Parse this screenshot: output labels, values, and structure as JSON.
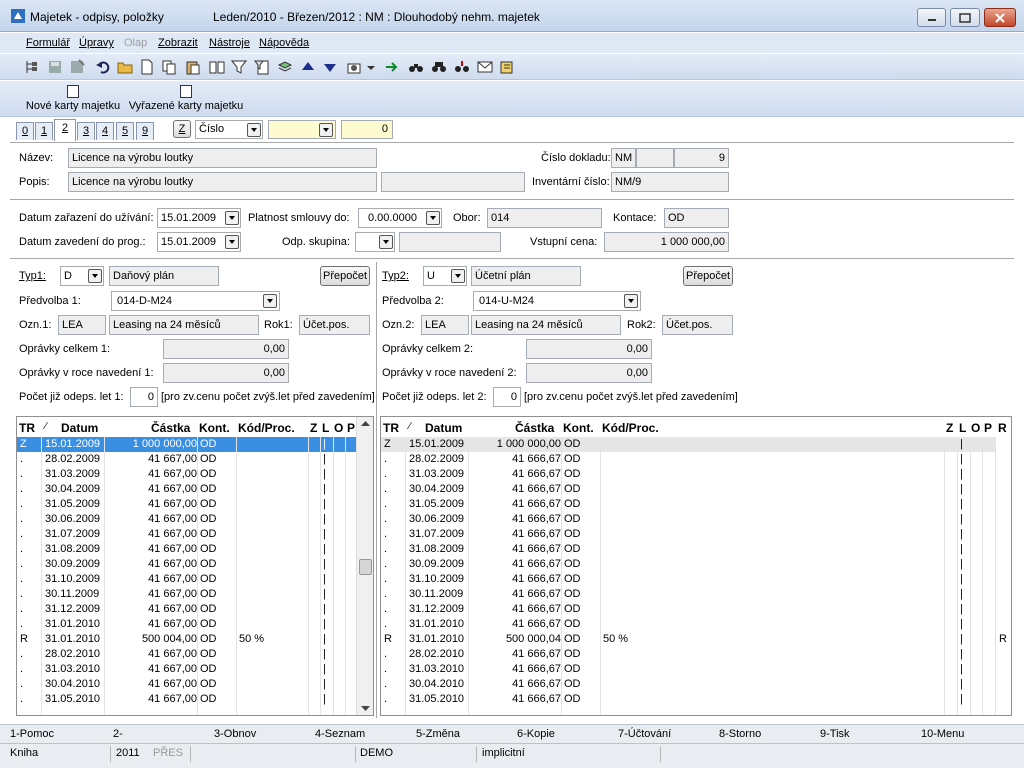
{
  "window": {
    "title": "Majetek - odpisy, položky",
    "subtitle": "Leden/2010 - Březen/2012 : NM : Dlouhodobý nehm. majetek"
  },
  "menu": [
    "Formulář",
    "Úpravy",
    "Olap",
    "Zobrazit",
    "Nástroje",
    "Nápověda"
  ],
  "toolbar2": {
    "new_cards": "Nové karty majetku",
    "discarded_cards": "Vyřazené karty majetku"
  },
  "tabs": [
    "0",
    "1",
    "2",
    "3",
    "4",
    "5",
    "9"
  ],
  "tabs_active": "2",
  "filter": {
    "z_label": "Z",
    "sort_field": "Číslo",
    "count": "0"
  },
  "header": {
    "nazev_label": "Název:",
    "nazev": "Licence na výrobu loutky",
    "popis_label": "Popis:",
    "popis": "Licence na výrobu loutky",
    "cislo_dokladu_label": "Číslo dokladu:",
    "doc_series": "NM",
    "doc_number": "9",
    "inventarni_label": "Inventární číslo:",
    "inventarni": "NM/9"
  },
  "dates": {
    "zarazeni_label": "Datum zařazení do užívání:",
    "zarazeni": "15.01.2009",
    "platnost_label": "Platnost smlouvy do:",
    "platnost": "0.00.0000",
    "obor_label": "Obor:",
    "obor": "014",
    "kontace_label": "Kontace:",
    "kontace": "OD",
    "zavedeni_label": "Datum zavedení do prog.:",
    "zavedeni": "15.01.2009",
    "skupina_label": "Odp. skupina:",
    "vstupni_label": "Vstupní cena:",
    "vstupni": "1 000 000,00"
  },
  "left": {
    "typ_label": "Typ1:",
    "typ": "D",
    "typ_name": "Daňový plán",
    "recalc": "Přepočet",
    "predvolba_label": "Předvolba 1:",
    "predvolba": "014-D-M24",
    "ozn_label": "Ozn.1:",
    "ozn": "LEA",
    "ozn_name": "Leasing na 24 měsíců",
    "rok_label": "Rok1:",
    "rok": "Účet.pos.",
    "opravky_celkem_label": "Oprávky celkem 1:",
    "opravky_celkem": "0,00",
    "opravky_roce_label": "Oprávky v roce navedení 1:",
    "opravky_roce": "0,00",
    "pocet_label": "Počet již odeps. let 1:",
    "pocet": "0",
    "pocet_note": "[pro zv.cenu počet zvýš.let před zavedením]"
  },
  "right": {
    "typ_label": "Typ2:",
    "typ": "U",
    "typ_name": "Účetní plán",
    "recalc": "Přepočet",
    "predvolba_label": "Předvolba 2:",
    "predvolba": "014-U-M24",
    "ozn_label": "Ozn.2:",
    "ozn": "LEA",
    "ozn_name": "Leasing na 24 měsíců",
    "rok_label": "Rok2:",
    "rok": "Účet.pos.",
    "opravky_celkem_label": "Oprávky celkem 2:",
    "opravky_celkem": "0,00",
    "opravky_roce_label": "Oprávky v roce navedení 2:",
    "opravky_roce": "0,00",
    "pocet_label": "Počet již odeps. let 2:",
    "pocet": "0",
    "pocet_note": "[pro zv.cenu počet zvýš.let před zavedením]"
  },
  "grid_columns": [
    "TR",
    "Datum",
    "Částka",
    "Kont.",
    "Kód/Proc.",
    "Z",
    "L",
    "O",
    "P",
    "R"
  ],
  "left_rows": [
    {
      "tr": "Z",
      "date": "15.01.2009",
      "amount": "1 000 000,00",
      "kont": "OD",
      "kod": ""
    },
    {
      "tr": ".",
      "date": "28.02.2009",
      "amount": "41 667,00",
      "kont": "OD",
      "kod": ""
    },
    {
      "tr": ".",
      "date": "31.03.2009",
      "amount": "41 667,00",
      "kont": "OD",
      "kod": ""
    },
    {
      "tr": ".",
      "date": "30.04.2009",
      "amount": "41 667,00",
      "kont": "OD",
      "kod": ""
    },
    {
      "tr": ".",
      "date": "31.05.2009",
      "amount": "41 667,00",
      "kont": "OD",
      "kod": ""
    },
    {
      "tr": ".",
      "date": "30.06.2009",
      "amount": "41 667,00",
      "kont": "OD",
      "kod": ""
    },
    {
      "tr": ".",
      "date": "31.07.2009",
      "amount": "41 667,00",
      "kont": "OD",
      "kod": ""
    },
    {
      "tr": ".",
      "date": "31.08.2009",
      "amount": "41 667,00",
      "kont": "OD",
      "kod": ""
    },
    {
      "tr": ".",
      "date": "30.09.2009",
      "amount": "41 667,00",
      "kont": "OD",
      "kod": ""
    },
    {
      "tr": ".",
      "date": "31.10.2009",
      "amount": "41 667,00",
      "kont": "OD",
      "kod": ""
    },
    {
      "tr": ".",
      "date": "30.11.2009",
      "amount": "41 667,00",
      "kont": "OD",
      "kod": ""
    },
    {
      "tr": ".",
      "date": "31.12.2009",
      "amount": "41 667,00",
      "kont": "OD",
      "kod": ""
    },
    {
      "tr": ".",
      "date": "31.01.2010",
      "amount": "41 667,00",
      "kont": "OD",
      "kod": ""
    },
    {
      "tr": "R",
      "date": "31.01.2010",
      "amount": "500 004,00",
      "kont": "OD",
      "kod": "50 %"
    },
    {
      "tr": ".",
      "date": "28.02.2010",
      "amount": "41 667,00",
      "kont": "OD",
      "kod": ""
    },
    {
      "tr": ".",
      "date": "31.03.2010",
      "amount": "41 667,00",
      "kont": "OD",
      "kod": ""
    },
    {
      "tr": ".",
      "date": "30.04.2010",
      "amount": "41 667,00",
      "kont": "OD",
      "kod": ""
    },
    {
      "tr": ".",
      "date": "31.05.2010",
      "amount": "41 667,00",
      "kont": "OD",
      "kod": ""
    }
  ],
  "right_rows": [
    {
      "tr": "Z",
      "date": "15.01.2009",
      "amount": "1 000 000,00",
      "kont": "OD",
      "kod": "",
      "r": ""
    },
    {
      "tr": ".",
      "date": "28.02.2009",
      "amount": "41 666,67",
      "kont": "OD",
      "kod": "",
      "r": ""
    },
    {
      "tr": ".",
      "date": "31.03.2009",
      "amount": "41 666,67",
      "kont": "OD",
      "kod": "",
      "r": ""
    },
    {
      "tr": ".",
      "date": "30.04.2009",
      "amount": "41 666,67",
      "kont": "OD",
      "kod": "",
      "r": ""
    },
    {
      "tr": ".",
      "date": "31.05.2009",
      "amount": "41 666,67",
      "kont": "OD",
      "kod": "",
      "r": ""
    },
    {
      "tr": ".",
      "date": "30.06.2009",
      "amount": "41 666,67",
      "kont": "OD",
      "kod": "",
      "r": ""
    },
    {
      "tr": ".",
      "date": "31.07.2009",
      "amount": "41 666,67",
      "kont": "OD",
      "kod": "",
      "r": ""
    },
    {
      "tr": ".",
      "date": "31.08.2009",
      "amount": "41 666,67",
      "kont": "OD",
      "kod": "",
      "r": ""
    },
    {
      "tr": ".",
      "date": "30.09.2009",
      "amount": "41 666,67",
      "kont": "OD",
      "kod": "",
      "r": ""
    },
    {
      "tr": ".",
      "date": "31.10.2009",
      "amount": "41 666,67",
      "kont": "OD",
      "kod": "",
      "r": ""
    },
    {
      "tr": ".",
      "date": "30.11.2009",
      "amount": "41 666,67",
      "kont": "OD",
      "kod": "",
      "r": ""
    },
    {
      "tr": ".",
      "date": "31.12.2009",
      "amount": "41 666,67",
      "kont": "OD",
      "kod": "",
      "r": ""
    },
    {
      "tr": ".",
      "date": "31.01.2010",
      "amount": "41 666,67",
      "kont": "OD",
      "kod": "",
      "r": ""
    },
    {
      "tr": "R",
      "date": "31.01.2010",
      "amount": "500 000,04",
      "kont": "OD",
      "kod": "50 %",
      "r": "R"
    },
    {
      "tr": ".",
      "date": "28.02.2010",
      "amount": "41 666,67",
      "kont": "OD",
      "kod": "",
      "r": ""
    },
    {
      "tr": ".",
      "date": "31.03.2010",
      "amount": "41 666,67",
      "kont": "OD",
      "kod": "",
      "r": ""
    },
    {
      "tr": ".",
      "date": "30.04.2010",
      "amount": "41 666,67",
      "kont": "OD",
      "kod": "",
      "r": ""
    },
    {
      "tr": ".",
      "date": "31.05.2010",
      "amount": "41 666,67",
      "kont": "OD",
      "kod": "",
      "r": ""
    }
  ],
  "fkeys": [
    "1-Pomoc",
    "2-",
    "3-Obnov",
    "4-Seznam",
    "5-Změna",
    "6-Kopie",
    "7-Účtování",
    "8-Storno",
    "9-Tisk",
    "10-Menu"
  ],
  "status": {
    "book": "Kniha",
    "year": "2011",
    "mode": "PŘES",
    "db": "DEMO",
    "profile": "implicitní"
  },
  "colors": {
    "selection": "#3b8fe3",
    "titlebar": "#c4d5ec",
    "field_bg": "#eeeeee"
  }
}
